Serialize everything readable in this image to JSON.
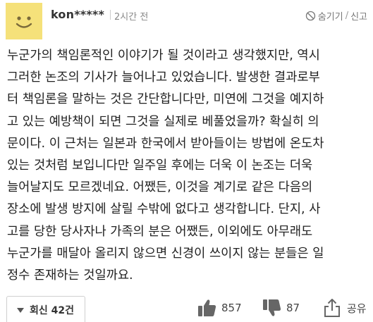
{
  "comment": {
    "username": "kon*****",
    "time": "2시간 전",
    "hide_label": "숨기기",
    "report_label": "신고",
    "divider": "/",
    "lines": [
      "누군가의 책임론적인 이야기가 될 것이라고 생각했지만, 역시",
      "그러한 논조의 기사가 늘어나고 있었습니다. 발생한 결과로부",
      "터 책임론을 말하는 것은 간단합니다만, 미연에 그것을 예지하",
      "고 있는 예방책이 되면 그것을 실제로 베풀었을까? 확실히 의",
      "문이다. 이 근처는 일본과 한국에서 받아들이는 방법에 온도차",
      "있는 것처럼 보입니다만 일주일 후에는 더욱 이 논조는 더욱",
      "늘어날지도 모르겠네요. 어쨌든, 이것을 계기로 같은 다음의",
      "장소에 발생 방지에 살릴 수밖에 없다고 생각합니다. 단지, 사",
      "고를 당한 당사자나 가족의 분은 어쨌든, 이외에도 아무래도",
      "누군가를 매달아 올리지 않으면 신경이 쓰이지 않는 분들은 일",
      "정수 존재하는 것일까요."
    ]
  },
  "footer": {
    "reply_label": "회신 42건",
    "like_count": "857",
    "dislike_count": "87",
    "share_label": "공유"
  },
  "icons": {
    "avatar": "smiley-face-avatar",
    "hide": "ban-icon",
    "reply": "triangle-down-icon",
    "like": "thumbs-up-icon",
    "dislike": "thumbs-down-icon",
    "share": "share-icon"
  },
  "colors": {
    "avatar_bg": "#f5e17a",
    "text": "#222222",
    "muted": "#888888"
  }
}
